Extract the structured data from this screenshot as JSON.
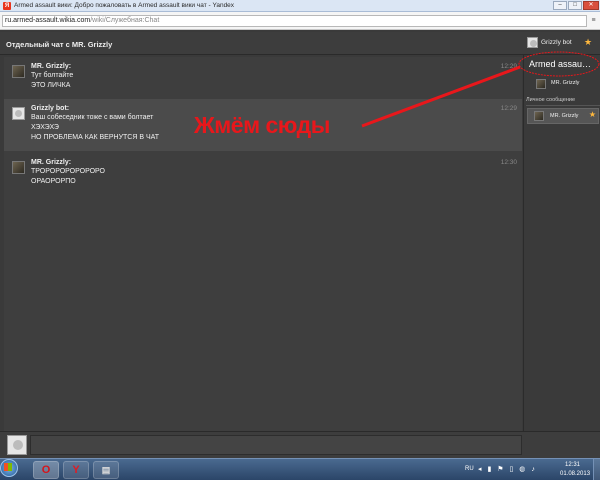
{
  "browser": {
    "window_title": "Armed assault вики: Добро пожаловать в Armed assault вики чат - Yandex",
    "url_host": "ru.armed-assault.wikia.com",
    "url_path": "/wiki/Служебная:Chat"
  },
  "chat": {
    "header_title": "Отдельный чат с MR. Grizzly",
    "header_user": "Grizzly bot",
    "messages": [
      {
        "author": "MR. Grizzly:",
        "time": "12:29",
        "lines": [
          "Тут болтайте",
          "ЭТО ЛИЧКА"
        ]
      },
      {
        "author": "Grizzly bot:",
        "time": "12:29",
        "lines": [
          "Ваш собеседник тоже с вами болтает",
          "ХЭХЭХЭ",
          "НО ПРОБЛЕМА КАК ВЕРНУТСЯ В ЧАТ"
        ]
      },
      {
        "author": "MR. Grizzly:",
        "time": "12:30",
        "lines": [
          "ТРОРОРОРОРОРОРО",
          "ОРАОРОРПО"
        ]
      }
    ]
  },
  "sidebar": {
    "room_name": "Armed assau…",
    "room_user": "MR. Grizzly",
    "private_label": "Личное сообщение",
    "private_user": "MR. Grizzly"
  },
  "annotation": {
    "text": "Жмём сюды",
    "color": "#e8171b"
  },
  "taskbar": {
    "lang": "RU",
    "time": "12:31",
    "date": "01.08.2013",
    "icons": [
      "windows-start-icon",
      "opera-icon",
      "yandex-browser-icon",
      "file-explorer-icon"
    ]
  },
  "colors": {
    "chat_bg": "#3e3e3e",
    "highlight_row": "#4b4b4b",
    "star": "#ffb83d"
  }
}
